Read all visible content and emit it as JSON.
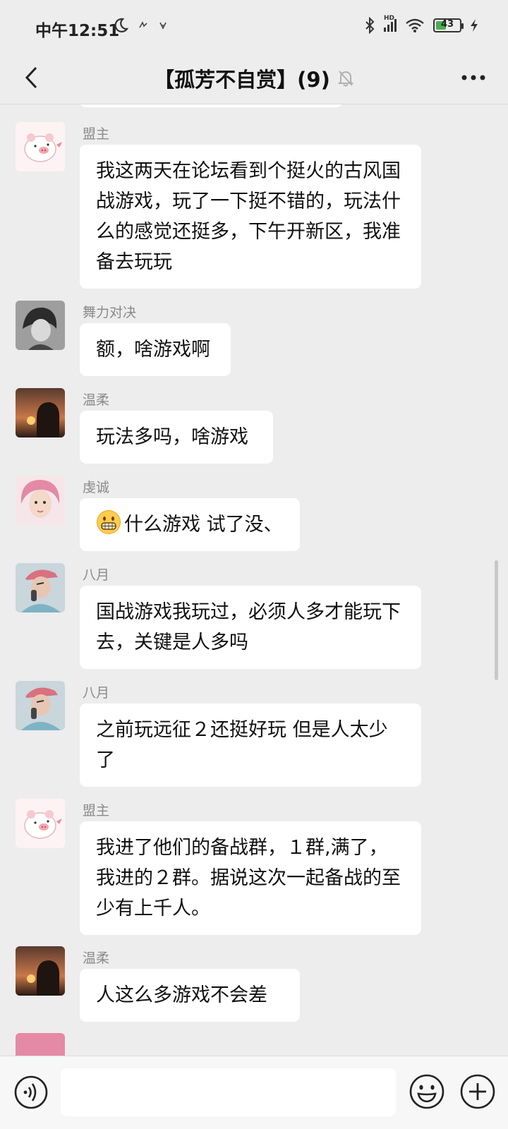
{
  "status": {
    "time": "中午12:51",
    "hd_label": "HD",
    "battery_level": "43",
    "battery_color": "#4caf50"
  },
  "nav": {
    "title": "【孤芳不自赏】(9)",
    "back_icon": "chevron-left-icon",
    "mute_icon": "bell-off-icon",
    "more_icon": "more-dots-icon"
  },
  "messages": [
    {
      "sender": "盟主",
      "text": "我这两天在论坛看到个挺火的古风国战游戏，玩了一下挺不错的，玩法什么的感觉还挺多，下午开新区，我准备去玩玩",
      "avatar": "pig-avatar"
    },
    {
      "sender": "舞力对决",
      "text": "额，啥游戏啊",
      "avatar": "anime-boy-avatar"
    },
    {
      "sender": "温柔",
      "text": "玩法多吗，啥游戏",
      "avatar": "sunset-silhouette-avatar"
    },
    {
      "sender": "虔诚",
      "emoji": "grinning-face-icon",
      "text": "什么游戏 试了没、",
      "avatar": "pink-hair-avatar"
    },
    {
      "sender": "八月",
      "text": "国战游戏我玩过，必须人多才能玩下去，关键是人多吗",
      "avatar": "boy-cap-avatar"
    },
    {
      "sender": "八月",
      "text": "之前玩远征２还挺好玩  但是人太少了",
      "avatar": "boy-cap-avatar"
    },
    {
      "sender": "盟主",
      "text": "我进了他们的备战群，１群,满了，我进的２群。据说这次一起备战的至少有上千人。",
      "avatar": "pig-avatar"
    },
    {
      "sender": "温柔",
      "text": "人这么多游戏不会差",
      "avatar": "sunset-silhouette-avatar"
    }
  ],
  "input": {
    "placeholder": "",
    "voice_icon": "voice-icon",
    "emoji_icon": "smiley-icon",
    "plus_icon": "plus-circle-icon"
  },
  "colors": {
    "background": "#ededed",
    "bubble": "#ffffff",
    "sender": "#8a8a8a"
  }
}
